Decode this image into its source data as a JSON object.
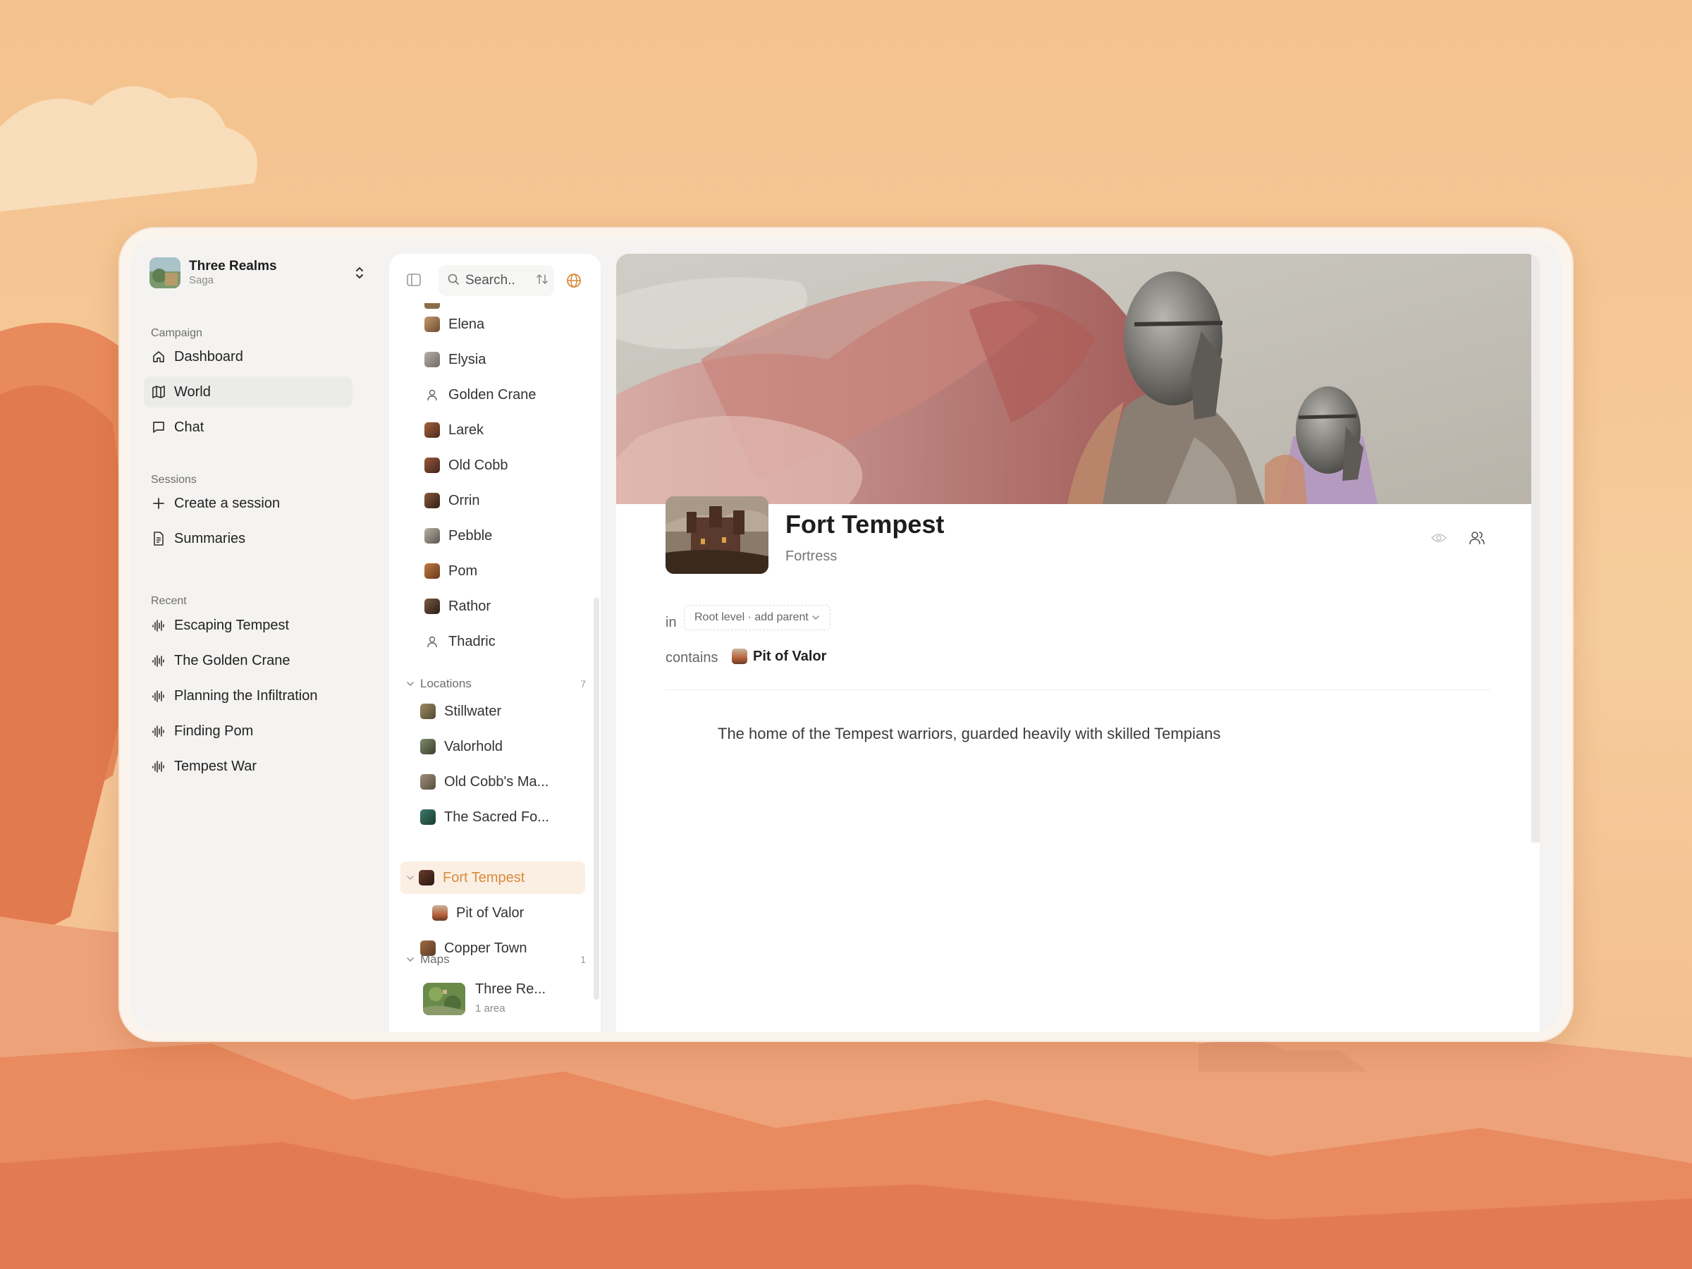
{
  "workspace": {
    "name": "Three Realms",
    "subtitle": "Saga"
  },
  "sidebar": {
    "campaign_label": "Campaign",
    "nav": [
      {
        "label": "Dashboard",
        "icon": "home-icon"
      },
      {
        "label": "World",
        "icon": "map-icon"
      },
      {
        "label": "Chat",
        "icon": "chat-icon"
      }
    ],
    "sessions_label": "Sessions",
    "sessions": [
      {
        "label": "Create a session",
        "icon": "plus-icon"
      },
      {
        "label": "Summaries",
        "icon": "document-icon"
      }
    ],
    "recent_label": "Recent",
    "recent": [
      {
        "label": "Escaping Tempest",
        "icon": "audio-wave-icon"
      },
      {
        "label": "The Golden Crane",
        "icon": "audio-wave-icon"
      },
      {
        "label": "Planning the Infiltration",
        "icon": "audio-wave-icon"
      },
      {
        "label": "Finding Pom",
        "icon": "audio-wave-icon"
      },
      {
        "label": "Tempest War",
        "icon": "audio-wave-icon"
      }
    ]
  },
  "tree": {
    "search_placeholder": "Search..",
    "characters": [
      "Elena",
      "Elysia",
      "Golden Crane",
      "Larek",
      "Old Cobb",
      "Orrin",
      "Pebble",
      "Pom",
      "Rathor",
      "Thadric"
    ],
    "locations_label": "Locations",
    "locations_count": "7",
    "locations": [
      "Stillwater",
      "Valorhold",
      "Old Cobb's Ma...",
      "The Sacred Fo...",
      "Fort Tempest",
      "Pit of Valor",
      "Copper Town"
    ],
    "maps_label": "Maps",
    "maps_count": "1",
    "map": {
      "name": "Three Re...",
      "sub": "1 area"
    }
  },
  "entity": {
    "title": "Fort Tempest",
    "type": "Fortress",
    "in_label": "in",
    "parent": "Root level · add parent",
    "contains_label": "contains",
    "child": "Pit of Valor",
    "description": "The home of the Tempest warriors, guarded heavily with skilled Tempians"
  },
  "colors": {
    "accent": "#d98a3a",
    "selected_bg": "#fbefe4",
    "window_bg": "#f4f3f1"
  }
}
